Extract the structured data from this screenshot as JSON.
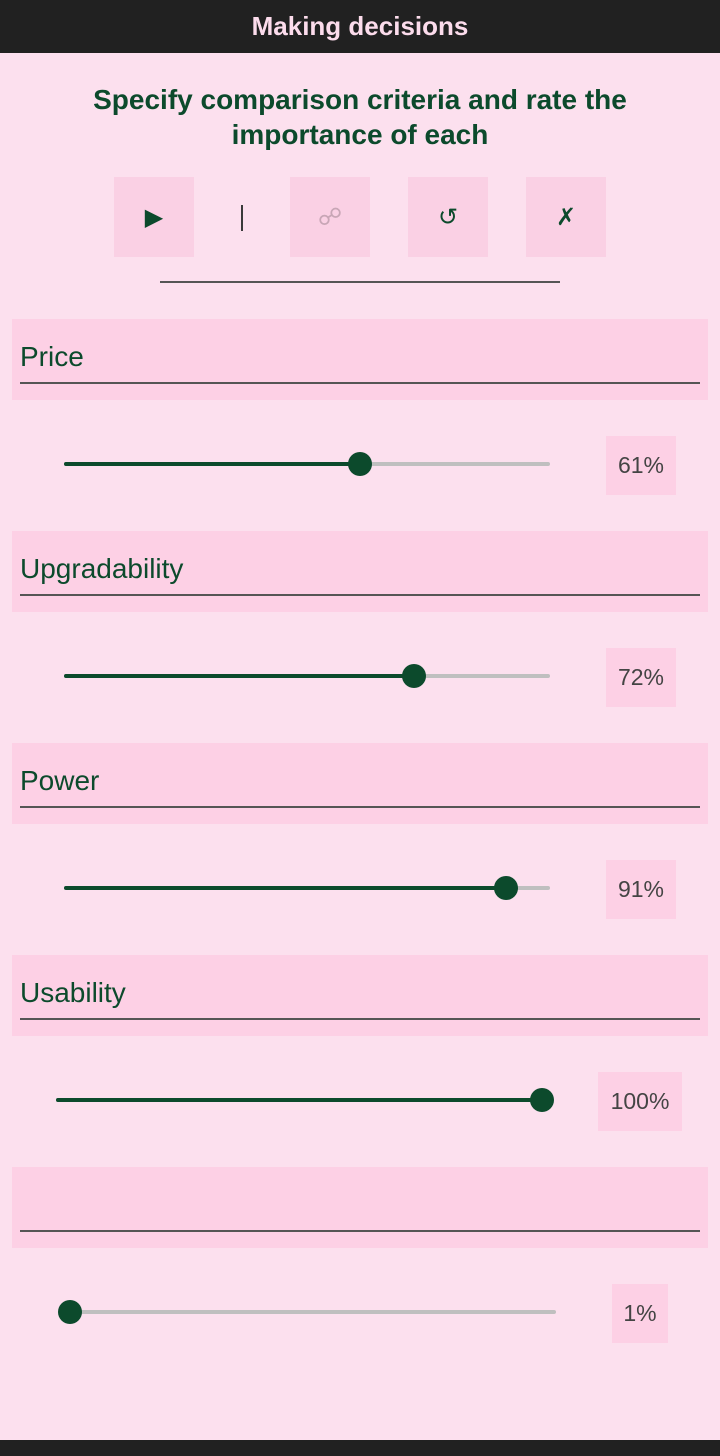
{
  "app": {
    "title": "Making decisions"
  },
  "heading": "Specify comparison criteria and rate the importance of each",
  "toolbar": {
    "play_icon": "▶",
    "separator": "|",
    "link_icon": "☍",
    "undo_icon": "↺",
    "close_icon": "✗"
  },
  "criteria": [
    {
      "name": "Price",
      "value": 61,
      "value_label": "61%"
    },
    {
      "name": "Upgradability",
      "value": 72,
      "value_label": "72%"
    },
    {
      "name": "Power",
      "value": 91,
      "value_label": "91%"
    },
    {
      "name": "Usability",
      "value": 100,
      "value_label": "100%"
    },
    {
      "name": "",
      "value": 1,
      "value_label": "1%"
    }
  ],
  "colors": {
    "accent": "#0c4a2c",
    "background": "#fce0ee",
    "field": "#fdd0e5",
    "bar": "#212121"
  }
}
